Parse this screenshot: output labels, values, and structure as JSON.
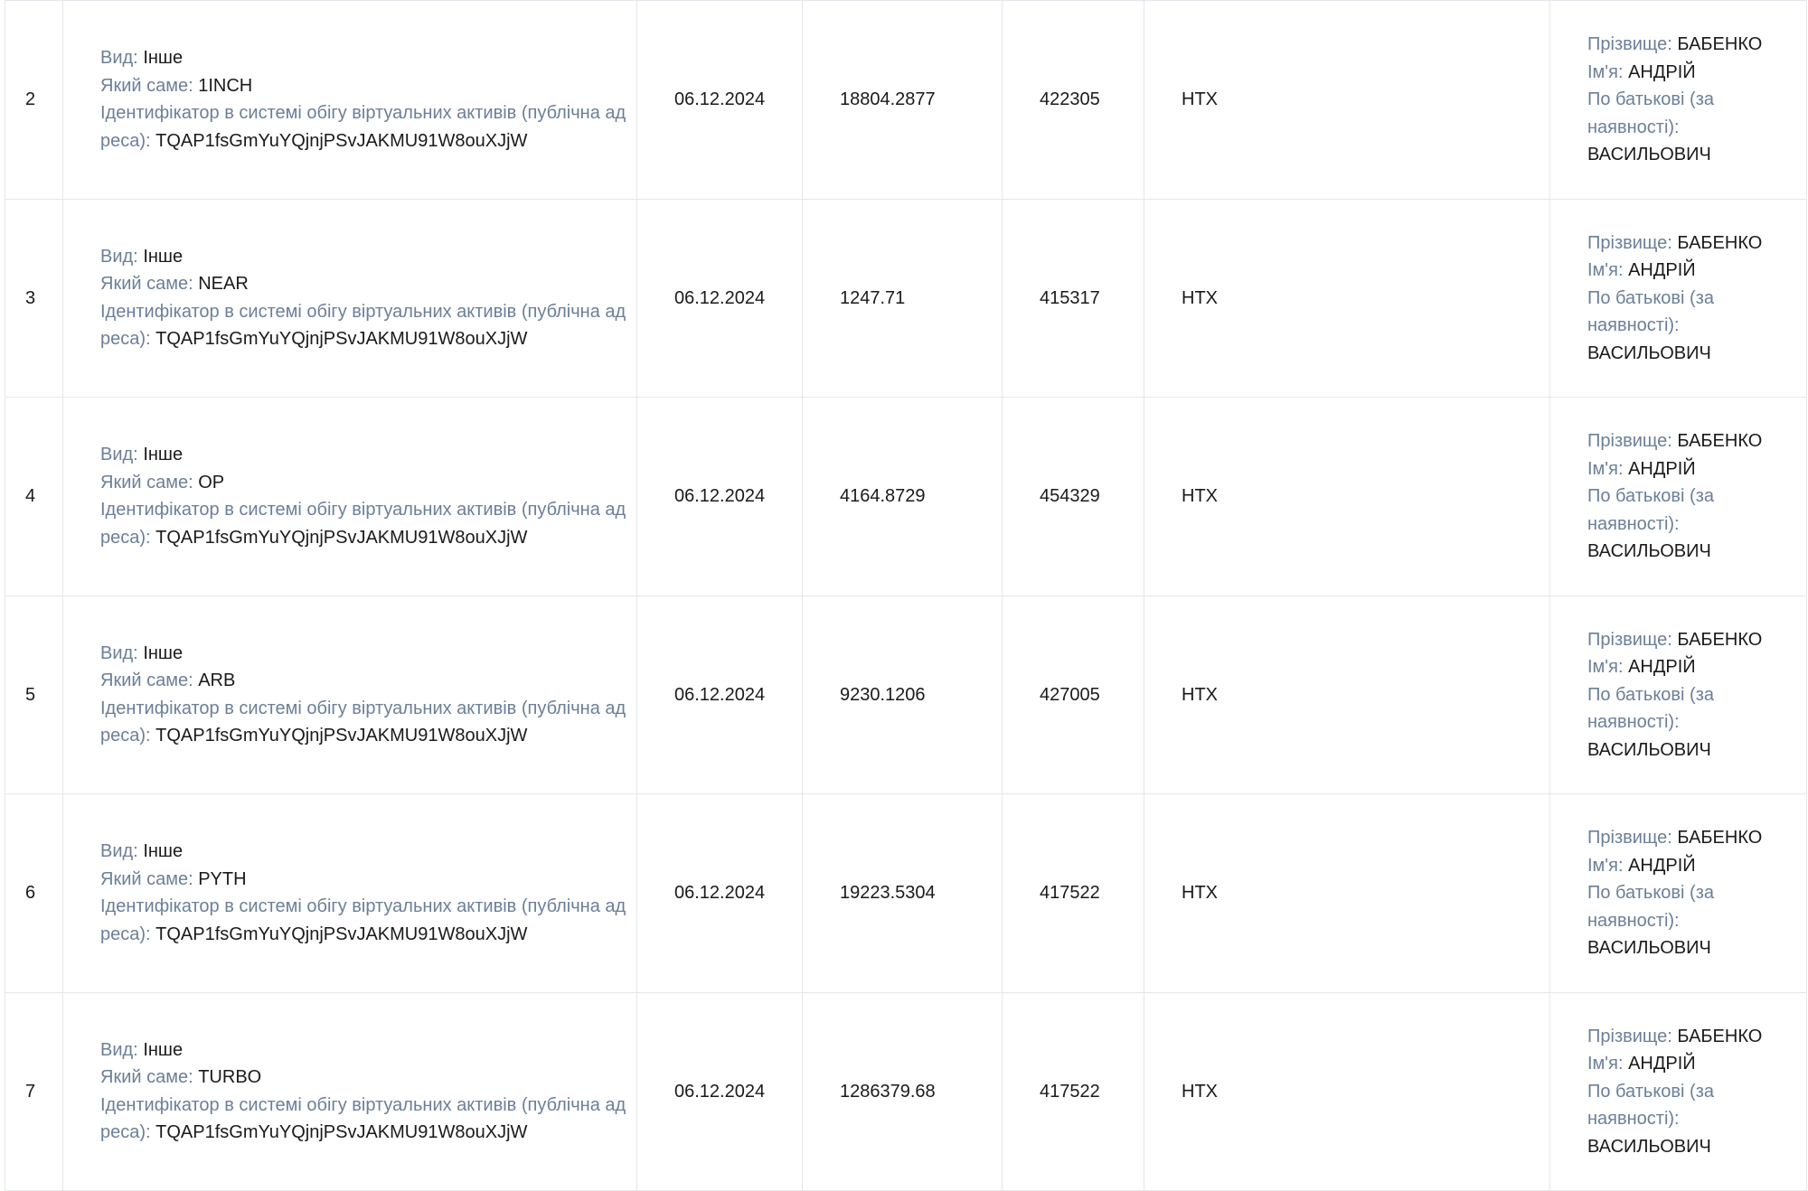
{
  "labels": {
    "kind": "Вид:",
    "which": "Який саме:",
    "identifier": "Ідентифікатор в системі обігу віртуальних активів (публічна адреса):",
    "surname": "Прізвище:",
    "name": "Ім'я:",
    "patronymic": "По батькові (за наявності):"
  },
  "rows": [
    {
      "num": "2",
      "kind": "Інше",
      "asset": "1INCH",
      "address": "TQAP1fsGmYuYQjnjPSvJAKMU91W8ouXJjW",
      "date": "06.12.2024",
      "amount": "18804.2877",
      "cost": "422305",
      "exchange": "HTX",
      "surname": "БАБЕНКО",
      "name": "АНДРІЙ",
      "patronymic": "ВАСИЛЬОВИЧ"
    },
    {
      "num": "3",
      "kind": "Інше",
      "asset": "NEAR",
      "address": "TQAP1fsGmYuYQjnjPSvJAKMU91W8ouXJjW",
      "date": "06.12.2024",
      "amount": "1247.71",
      "cost": "415317",
      "exchange": "HTX",
      "surname": "БАБЕНКО",
      "name": "АНДРІЙ",
      "patronymic": "ВАСИЛЬОВИЧ"
    },
    {
      "num": "4",
      "kind": "Інше",
      "asset": "OP",
      "address": "TQAP1fsGmYuYQjnjPSvJAKMU91W8ouXJjW",
      "date": "06.12.2024",
      "amount": "4164.8729",
      "cost": "454329",
      "exchange": "HTX",
      "surname": "БАБЕНКО",
      "name": "АНДРІЙ",
      "patronymic": "ВАСИЛЬОВИЧ"
    },
    {
      "num": "5",
      "kind": "Інше",
      "asset": "ARB",
      "address": "TQAP1fsGmYuYQjnjPSvJAKMU91W8ouXJjW",
      "date": "06.12.2024",
      "amount": "9230.1206",
      "cost": "427005",
      "exchange": "HTX",
      "surname": "БАБЕНКО",
      "name": "АНДРІЙ",
      "patronymic": "ВАСИЛЬОВИЧ"
    },
    {
      "num": "6",
      "kind": "Інше",
      "asset": "PYTH",
      "address": "TQAP1fsGmYuYQjnjPSvJAKMU91W8ouXJjW",
      "date": "06.12.2024",
      "amount": "19223.5304",
      "cost": "417522",
      "exchange": "HTX",
      "surname": "БАБЕНКО",
      "name": "АНДРІЙ",
      "patronymic": "ВАСИЛЬОВИЧ"
    },
    {
      "num": "7",
      "kind": "Інше",
      "asset": "TURBO",
      "address": "TQAP1fsGmYuYQjnjPSvJAKMU91W8ouXJjW",
      "date": "06.12.2024",
      "amount": "1286379.68",
      "cost": "417522",
      "exchange": "HTX",
      "surname": "БАБЕНКО",
      "name": "АНДРІЙ",
      "patronymic": "ВАСИЛЬОВИЧ"
    }
  ]
}
